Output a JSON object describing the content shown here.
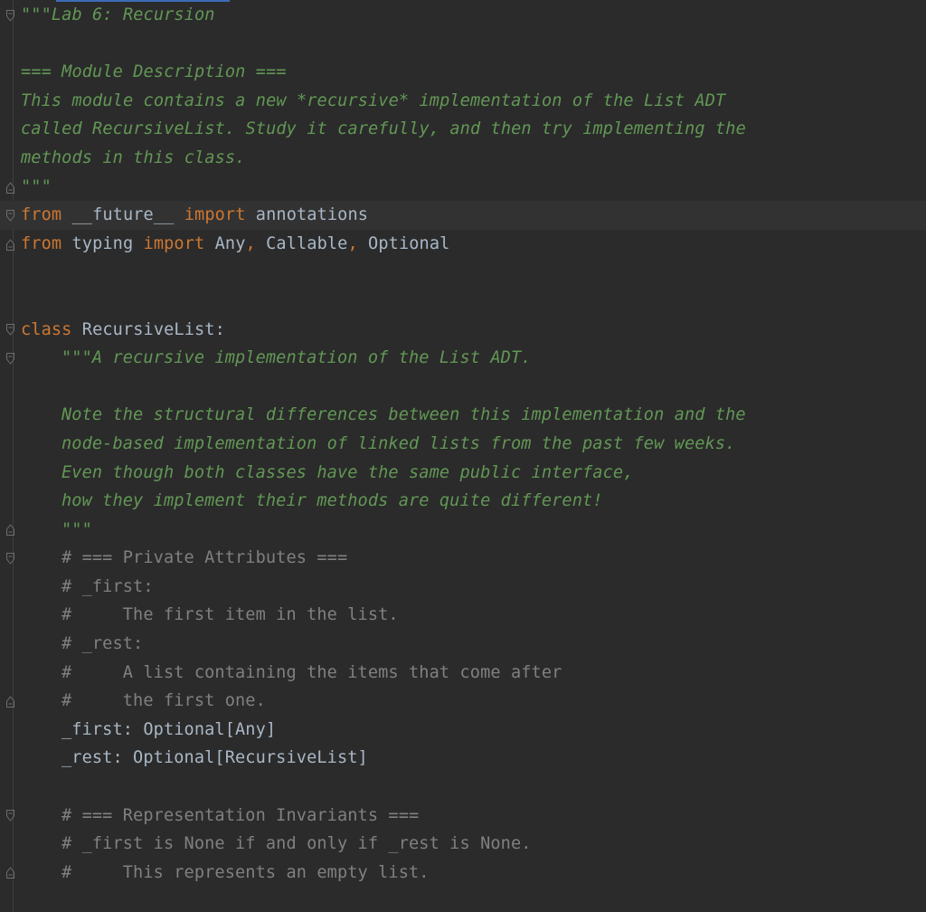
{
  "colors": {
    "background": "#2b2b2b",
    "docstring": "#629755",
    "keyword": "#cc7832",
    "comment": "#808080",
    "text": "#a9b7c6",
    "top_indicator": "#3d6bb8"
  },
  "code": {
    "l1": "\"\"\"Lab 6: Recursion",
    "l2": "",
    "l3": "=== Module Description ===",
    "l4": "This module contains a new *recursive* implementation of the List ADT",
    "l5": "called RecursiveList. Study it carefully, and then try implementing the",
    "l6": "methods in this class.",
    "l7": "\"\"\"",
    "l8": {
      "kw_from": "from",
      "module": " __future__ ",
      "kw_import": "import",
      "names": " annotations"
    },
    "l9": {
      "kw_from": "from",
      "module": " typing ",
      "kw_import": "import",
      "name1": " Any",
      "comma1": ",",
      "name2": " Callable",
      "comma2": ",",
      "name3": " Optional"
    },
    "l12": {
      "kw_class": "class",
      "name": " RecursiveList:"
    },
    "l13": "\"\"\"A recursive implementation of the List ADT.",
    "l15": "Note the structural differences between this implementation and the",
    "l16": "node-based implementation of linked lists from the past few weeks.",
    "l17": "Even though both classes have the same public interface,",
    "l18": "how they implement their methods are quite different!",
    "l19": "\"\"\"",
    "l20": "# === Private Attributes ===",
    "l21": "# _first:",
    "l22": "#     The first item in the list.",
    "l23": "# _rest:",
    "l24": "#     A list containing the items that come after",
    "l25": "#     the first one.",
    "l26": "_first: Optional[Any]",
    "l27": "_rest: Optional[RecursiveList]",
    "l29": "# === Representation Invariants ===",
    "l30": "# _first is None if and only if _rest is None.",
    "l31": "#     This represents an empty list."
  }
}
